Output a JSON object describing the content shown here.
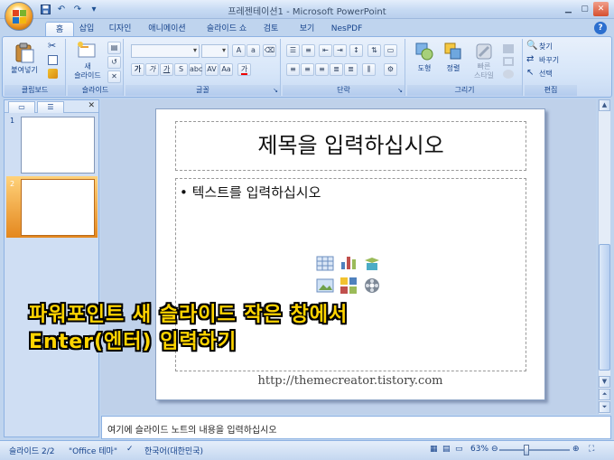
{
  "window": {
    "title": "프레젠테이션1 - Microsoft PowerPoint"
  },
  "quick_access": {
    "icons": [
      "save-icon",
      "undo-icon",
      "redo-icon",
      "customize-icon"
    ]
  },
  "tabs": [
    {
      "label": "홈",
      "active": true
    },
    {
      "label": "삽입"
    },
    {
      "label": "디자인"
    },
    {
      "label": "애니메이션"
    },
    {
      "label": "슬라이드 쇼"
    },
    {
      "label": "검토"
    },
    {
      "label": "보기"
    },
    {
      "label": "NesPDF"
    }
  ],
  "ribbon": {
    "clipboard": {
      "paste_label": "붙여넣기",
      "group_label": "클립보드"
    },
    "slides": {
      "new_slide_label": "새\n슬라이드",
      "group_label": "슬라이드"
    },
    "font": {
      "group_label": "글꼴",
      "font_name": "",
      "font_size": ""
    },
    "paragraph": {
      "group_label": "단락"
    },
    "drawing": {
      "shape_label": "도형",
      "arrange_label": "정렬",
      "quick_style_label": "빠른\n스타일",
      "group_label": "그리기"
    },
    "editing": {
      "find_label": "찾기",
      "replace_label": "바꾸기",
      "select_label": "선택",
      "group_label": "편집"
    }
  },
  "slide_panel": {
    "thumbnails": [
      {
        "number": "1"
      },
      {
        "number": "2",
        "selected": true
      }
    ]
  },
  "slide": {
    "title_placeholder": "제목을 입력하십시오",
    "body_placeholder": "텍스트를 입력하십시오",
    "footer_url": "http://themecreator.tistory.com"
  },
  "overlay": {
    "line1": "파워포인트 새 슬라이드 작은 창에서",
    "line2": "Enter(엔터) 입력하기"
  },
  "notes": {
    "placeholder": "여기에 슬라이드 노트의 내용을 입력하십시오"
  },
  "status": {
    "slide_counter": "슬라이드 2/2",
    "theme": "\"Office 테마\"",
    "language": "한국어(대한민국)",
    "zoom": "63%"
  },
  "colors": {
    "ribbon_bg": "#d7e6f9",
    "overlay_text": "#ffd400",
    "selected_thumb": "#f0a559"
  }
}
